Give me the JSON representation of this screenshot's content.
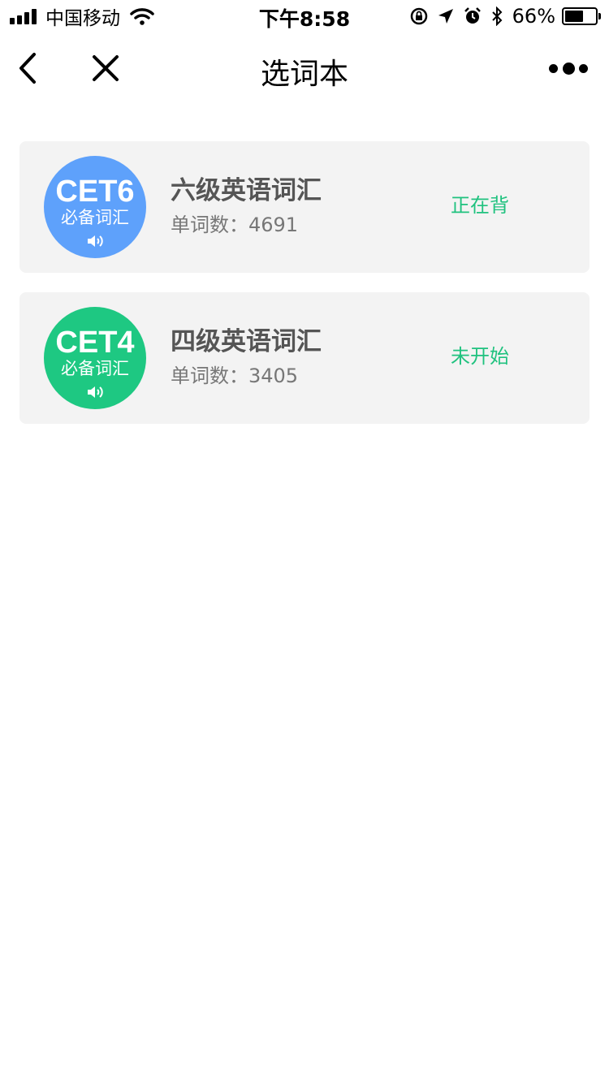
{
  "status_bar": {
    "carrier": "中国移动",
    "time": "下午8:58",
    "battery_percent": "66%",
    "battery_level": 0.66,
    "icons": [
      "signal-icon",
      "wifi-icon",
      "orientation-lock-icon",
      "location-icon",
      "alarm-icon",
      "bluetooth-icon",
      "battery-icon"
    ]
  },
  "nav": {
    "title": "选词本",
    "icons": [
      "back-icon",
      "close-icon",
      "more-icon"
    ]
  },
  "wordbooks": [
    {
      "badge_code": "CET6",
      "badge_sub": "必备词汇",
      "badge_color": "#5ea1fb",
      "title": "六级英语词汇",
      "count_label": "单词数：",
      "count": "4691",
      "status": "正在背"
    },
    {
      "badge_code": "CET4",
      "badge_sub": "必备词汇",
      "badge_color": "#1ec882",
      "title": "四级英语词汇",
      "count_label": "单词数：",
      "count": "3405",
      "status": "未开始"
    }
  ],
  "colors": {
    "status_text": "#20c27f",
    "card_background": "#f3f3f3"
  }
}
